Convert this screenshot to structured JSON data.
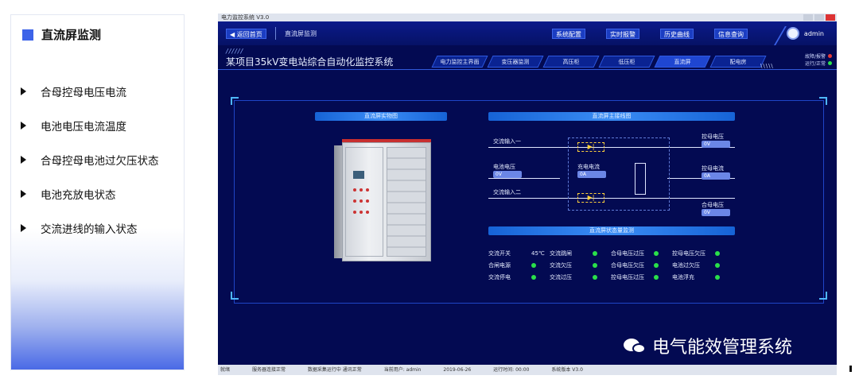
{
  "left_panel": {
    "title": "直流屏监测",
    "items": [
      {
        "label": "合母控母电压电流"
      },
      {
        "label": "电池电压电流温度"
      },
      {
        "label": "合母控母电池过欠压状态"
      },
      {
        "label": "电池充放电状态"
      },
      {
        "label": "交流进线的输入状态"
      }
    ]
  },
  "window": {
    "titlebar_text": "电力监控系统 V3.0"
  },
  "toolbar": {
    "back_label": "◀ 返回首页",
    "breadcrumb": "直流屏监测",
    "buttons": [
      "系统配置",
      "实时报警",
      "历史曲线",
      "信息查询"
    ],
    "user_name": "admin"
  },
  "header": {
    "stripes": "//////",
    "system_title": "某项目35kV变电站综合自动化监控系统",
    "tabs": [
      "电力监控主界面",
      "变压器监测",
      "高压柜",
      "低压柜",
      "直流屏",
      "配电房"
    ],
    "active_tab_index": 4,
    "marks": "\\\\\\\\\\",
    "legend": [
      {
        "label": "故障/报警",
        "color": "#e53935"
      },
      {
        "label": "运行/正常",
        "color": "#2adf4a"
      }
    ]
  },
  "panel": {
    "cabinet_title": "直流屏实物图",
    "wiring_title": "直流屏主接线图",
    "status_title": "直流屏状态量监测"
  },
  "schematic": {
    "ac_in_1": "交流输入一",
    "ac_in_2": "交流输入二",
    "battery_voltage_label": "电池电压",
    "battery_voltage_value": "0V",
    "charge_current_label": "充电电流",
    "charge_current_value": "0A",
    "control_bus_label": "控母电压",
    "control_bus_value": "0V",
    "control_current_label": "控母电流",
    "control_current_value": "0A",
    "closing_bus_label": "合母电压",
    "closing_bus_value": "0V"
  },
  "status_table": {
    "rows": [
      [
        {
          "label": "交流开关",
          "value": "45℃"
        },
        {
          "label": "交流跳闸",
          "led": "#2adf4a"
        },
        {
          "label": "合母电压过压",
          "led": "#2adf4a"
        },
        {
          "label": "控母电压欠压",
          "led": "#2adf4a"
        }
      ],
      [
        {
          "label": "合闸电源",
          "led": "#2adf4a"
        },
        {
          "label": "交流欠压",
          "led": "#2adf4a"
        },
        {
          "label": "合母电压欠压",
          "led": "#2adf4a"
        },
        {
          "label": "电池过欠压",
          "led": "#2adf4a"
        }
      ],
      [
        {
          "label": "交流停电",
          "led": "#2adf4a"
        },
        {
          "label": "交流过压",
          "led": "#2adf4a"
        },
        {
          "label": "控母电压过压",
          "led": "#2adf4a"
        },
        {
          "label": "电池浮充",
          "led": "#2adf4a"
        }
      ]
    ]
  },
  "watermark": {
    "text": "电气能效管理系统"
  },
  "statusbar": {
    "items": [
      "就绪",
      "服务器连接正常",
      "数据采集运行中 通讯正常",
      "当前用户: admin",
      "2019-06-26",
      "运行时间: 00:00",
      "系统版本 V3.0"
    ]
  }
}
